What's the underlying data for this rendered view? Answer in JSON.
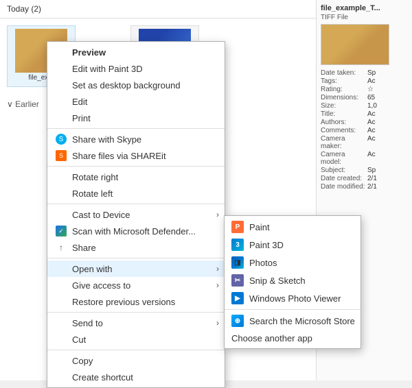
{
  "explorer": {
    "header": "Today (2)",
    "earlier_label": "Earlier",
    "files": [
      {
        "name": "file_ex...",
        "type": "tiff"
      },
      {
        "name": "",
        "type": "tiff2"
      }
    ]
  },
  "right_panel": {
    "title": "file_example_T...",
    "subtitle": "TIFF File",
    "details": [
      {
        "key": "Date taken:",
        "val": "Sp"
      },
      {
        "key": "Tags:",
        "val": "Ac"
      },
      {
        "key": "Rating:",
        "val": "☆"
      },
      {
        "key": "Dimensions:",
        "val": "65"
      },
      {
        "key": "Size:",
        "val": "1,0"
      },
      {
        "key": "Title:",
        "val": "Ac"
      },
      {
        "key": "Authors:",
        "val": "Ac"
      },
      {
        "key": "Comments:",
        "val": "Ac"
      },
      {
        "key": "Camera maker:",
        "val": "Ac"
      },
      {
        "key": "Camera model:",
        "val": "Ac"
      },
      {
        "key": "Subject:",
        "val": "Sp"
      },
      {
        "key": "Date created:",
        "val": "2/1"
      },
      {
        "key": "Date modified:",
        "val": "2/1"
      }
    ]
  },
  "context_menu": {
    "items": [
      {
        "label": "Preview",
        "bold": true,
        "icon": null
      },
      {
        "label": "Edit with Paint 3D",
        "icon": null
      },
      {
        "label": "Set as desktop background",
        "icon": null
      },
      {
        "label": "Edit",
        "icon": null
      },
      {
        "label": "Print",
        "icon": null
      },
      {
        "label": "Share with Skype",
        "icon": "skype"
      },
      {
        "label": "Share files via SHAREit",
        "icon": "shareit"
      },
      {
        "label": "Rotate right",
        "icon": null
      },
      {
        "label": "Rotate left",
        "icon": null
      },
      {
        "label": "Cast to Device",
        "icon": null,
        "arrow": true
      },
      {
        "label": "Scan with Microsoft Defender...",
        "icon": "defender"
      },
      {
        "label": "Share",
        "icon": "share"
      },
      {
        "label": "Open with",
        "icon": null,
        "arrow": true,
        "highlighted": true
      },
      {
        "label": "Give access to",
        "icon": null,
        "arrow": true
      },
      {
        "label": "Restore previous versions",
        "icon": null
      },
      {
        "label": "Send to",
        "icon": null,
        "arrow": true
      },
      {
        "label": "Cut",
        "icon": null
      },
      {
        "label": "Copy",
        "icon": null
      },
      {
        "label": "Create shortcut",
        "icon": null
      }
    ]
  },
  "submenu": {
    "items": [
      {
        "label": "Paint",
        "icon": "paint"
      },
      {
        "label": "Paint 3D",
        "icon": "paint3d"
      },
      {
        "label": "Photos",
        "icon": "photos"
      },
      {
        "label": "Snip & Sketch",
        "icon": "snip"
      },
      {
        "label": "Windows Photo Viewer",
        "icon": "viewer"
      }
    ],
    "separator": true,
    "extra_items": [
      {
        "label": "Search the Microsoft Store",
        "icon": "store"
      },
      {
        "label": "Choose another app",
        "icon": null
      }
    ]
  }
}
